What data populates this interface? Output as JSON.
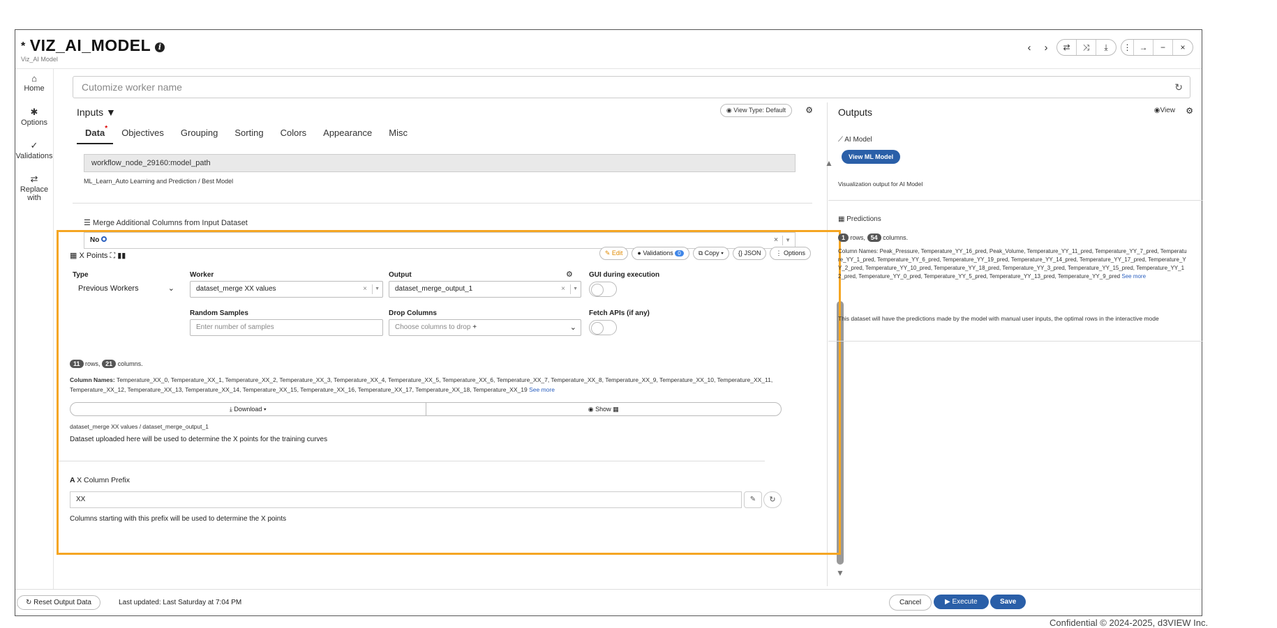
{
  "app": {
    "title": "VIZ_AI_MODEL",
    "modified_marker": "*",
    "subtitle": "Viz_AI Model"
  },
  "window_controls": {
    "prev": "‹",
    "next": "›",
    "swap": "⇄",
    "shuffle": "⤨",
    "download": "⤓",
    "more": "⋮",
    "expand": "→",
    "minimize": "−",
    "close": "×"
  },
  "nav": [
    {
      "label": "Home",
      "icon": "home-icon",
      "glyph": "⌂"
    },
    {
      "label": "Options",
      "icon": "gear-icon",
      "glyph": "✱"
    },
    {
      "label": "Validations",
      "icon": "check-icon",
      "glyph": "✓"
    },
    {
      "label": "Replace with",
      "icon": "swap-icon",
      "glyph": "⇄"
    }
  ],
  "worker_name": {
    "placeholder": "Cutomize worker name"
  },
  "inputs": {
    "title": "Inputs",
    "view_type": "View Type: Default",
    "tabs": [
      "Data",
      "Objectives",
      "Grouping",
      "Sorting",
      "Colors",
      "Appearance",
      "Misc"
    ],
    "model_path": "workflow_node_29160:model_path",
    "model_path_caption": "ML_Learn_Auto Learning and Prediction / Best Model",
    "merge_label": "Merge Additional Columns from Input Dataset",
    "merge_value": "No"
  },
  "xpoints": {
    "title": "X Points",
    "actions": {
      "edit": "Edit",
      "validations": "Validations",
      "validations_count": "0",
      "copy": "Copy",
      "json": "JSON",
      "options": "Options"
    },
    "type_label": "Type",
    "type_value": "Previous Workers",
    "worker_label": "Worker",
    "worker_value": "dataset_merge XX values",
    "output_label": "Output",
    "output_value": "dataset_merge_output_1",
    "gui_label": "GUI during execution",
    "random_label": "Random Samples",
    "random_placeholder": "Enter number of samples",
    "drop_label": "Drop Columns",
    "drop_placeholder": "Choose columns to drop",
    "fetch_label": "Fetch APIs (if any)",
    "rows": "11",
    "rows_suffix": "rows,",
    "cols": "21",
    "cols_suffix": "columns.",
    "column_names_label": "Column Names:",
    "column_names": "Temperature_XX_0, Temperature_XX_1, Temperature_XX_2, Temperature_XX_3, Temperature_XX_4, Temperature_XX_5, Temperature_XX_6, Temperature_XX_7, Temperature_XX_8, Temperature_XX_9, Temperature_XX_10, Temperature_XX_11, Temperature_XX_12, Temperature_XX_13, Temperature_XX_14, Temperature_XX_15, Temperature_XX_16, Temperature_XX_17, Temperature_XX_18, Temperature_XX_19",
    "see_more": "See more",
    "download": "Download",
    "show": "Show",
    "path_caption": "dataset_merge XX values / dataset_merge_output_1",
    "description": "Dataset uploaded here will be used to determine the X points for the training curves"
  },
  "prefix": {
    "label": "X Column Prefix",
    "value": "XX",
    "description": "Columns starting with this prefix will be used to determine the X points"
  },
  "outputs": {
    "title": "Outputs",
    "view": "View",
    "ai_model_label": "AI Model",
    "view_ml_button": "View ML Model",
    "viz_caption": "Visualization output for AI Model",
    "predictions_label": "Predictions",
    "rows": "1",
    "rows_suffix": "rows,",
    "cols": "54",
    "cols_suffix": "columns.",
    "column_names": "Column Names: Peak_Pressure, Temperature_YY_16_pred, Peak_Volume, Temperature_YY_11_pred, Temperature_YY_7_pred, Temperature_YY_1_pred, Temperature_YY_6_pred, Temperature_YY_19_pred, Temperature_YY_14_pred, Temperature_YY_17_pred, Temperature_YY_2_pred, Temperature_YY_10_pred, Temperature_YY_18_pred, Temperature_YY_3_pred, Temperature_YY_15_pred, Temperature_YY_12_pred, Temperature_YY_0_pred, Temperature_YY_5_pred, Temperature_YY_13_pred, Temperature_YY_9_pred",
    "see_more": "See more",
    "predictions_desc": "This dataset will have the predictions made by the model with manual user inputs, the optimal rows in the interactive mode"
  },
  "footer": {
    "reset": "Reset Output Data",
    "last_updated": "Last updated: Last Saturday at 7:04 PM",
    "cancel": "Cancel",
    "execute": "Execute",
    "save": "Save"
  },
  "confidential": "Confidential © 2024-2025, d3VIEW Inc."
}
